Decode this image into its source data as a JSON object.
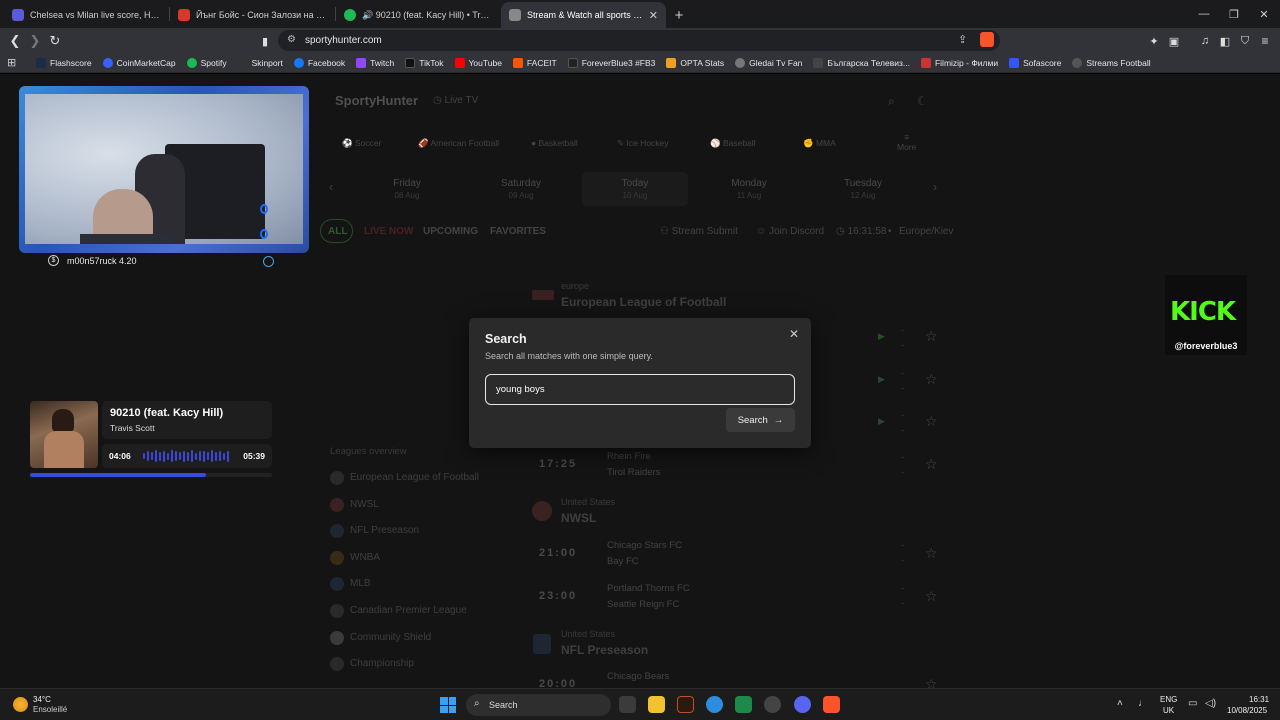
{
  "browser": {
    "tabs": [
      {
        "title": "Chelsea vs Milan live score, H2H and",
        "color": "#5b5bd6"
      },
      {
        "title": "Йънг Бойс - Сион Залози на живо |",
        "color": "#d43a2a"
      },
      {
        "title": "🔊 90210 (feat. Kacy Hill) • Travis Sco",
        "color": "#1db954"
      },
      {
        "title": "Stream & Watch all sports | Toda",
        "color": "#888888",
        "active": true
      }
    ],
    "url": "sportyhunter.com",
    "bookmarks": [
      {
        "label": "Flashscore",
        "color": "#1c2c44"
      },
      {
        "label": "CoinMarketCap",
        "color": "#3861fb"
      },
      {
        "label": "Spotify",
        "color": "#1db954"
      },
      {
        "label": "Skinport",
        "color": "#333333"
      },
      {
        "label": "Facebook",
        "color": "#1877f2"
      },
      {
        "label": "Twitch",
        "color": "#9146ff"
      },
      {
        "label": "TikTok",
        "color": "#111111"
      },
      {
        "label": "YouTube",
        "color": "#ff0000"
      },
      {
        "label": "FACEIT",
        "color": "#ff5500"
      },
      {
        "label": "ForeverBlue3 #FB3",
        "color": "#222222"
      },
      {
        "label": "OPTA Stats",
        "color": "#f0a020"
      },
      {
        "label": "Gledai Tv Fan",
        "color": "#777777"
      },
      {
        "label": "Българска Телевиз...",
        "color": "#444444"
      },
      {
        "label": "Filmizip - Филми",
        "color": "#cc3333"
      },
      {
        "label": "Sofascore",
        "color": "#3355ff"
      },
      {
        "label": "Streams Football",
        "color": "#555555"
      }
    ]
  },
  "site": {
    "logo": "SportyHunter",
    "live_tv": "Live TV",
    "sports": [
      "Soccer",
      "American Football",
      "Basketball",
      "Ice Hockey",
      "Baseball",
      "MMA",
      "More"
    ],
    "days": [
      {
        "name": "Friday",
        "date": "08 Aug"
      },
      {
        "name": "Saturday",
        "date": "09 Aug"
      },
      {
        "name": "Today",
        "date": "10 Aug"
      },
      {
        "name": "Monday",
        "date": "11 Aug"
      },
      {
        "name": "Tuesday",
        "date": "12 Aug"
      }
    ],
    "filters": [
      "ALL",
      "LIVE NOW",
      "UPCOMING",
      "FAVORITES"
    ],
    "stream_submit": "Stream Submit",
    "join_discord": "Join Discord",
    "clock": "16:31:58",
    "timezone": "Europe/Kiev",
    "sections": [
      {
        "country": "europe",
        "name": "European League of Football"
      },
      {
        "country": "United States",
        "name": "NWSL"
      },
      {
        "country": "United States",
        "name": "NFL Preseason"
      }
    ],
    "matches": [
      {
        "time": "17:25",
        "home": "Rhein Fire",
        "away": "Tirol Raiders"
      },
      {
        "time": "21:00",
        "home": "Chicago Stars FC",
        "away": "Bay FC"
      },
      {
        "time": "23:00",
        "home": "Portland Thorns FC",
        "away": "Seattle Reign FC"
      },
      {
        "time": "20:00",
        "home": "Chicago Bears",
        "away": ""
      }
    ],
    "score_placeholder": "-",
    "leagues_title": "Leagues overview",
    "leagues": [
      "European League of Football",
      "NWSL",
      "NFL Preseason",
      "WNBA",
      "MLB",
      "Canadian Premier League",
      "Community Shield",
      "Championship"
    ]
  },
  "modal": {
    "title": "Search",
    "subtitle": "Search all matches with one simple query.",
    "query": "young boys",
    "button": "Search"
  },
  "overlay": {
    "cam_user": "m00n57ruck 4.20",
    "song": "90210 (feat. Kacy Hill)",
    "artist": "Travis Scott",
    "elapsed": "04:06",
    "duration": "05:39",
    "progress": 0.726,
    "kick_logo": "KICK",
    "kick_user": "@foreverblue3"
  },
  "taskbar": {
    "temp": "34°C",
    "condition": "Ensoleillé",
    "search": "Search",
    "lang1": "ENG",
    "lang2": "UK",
    "time": "16:31",
    "date": "10/08/2025"
  }
}
